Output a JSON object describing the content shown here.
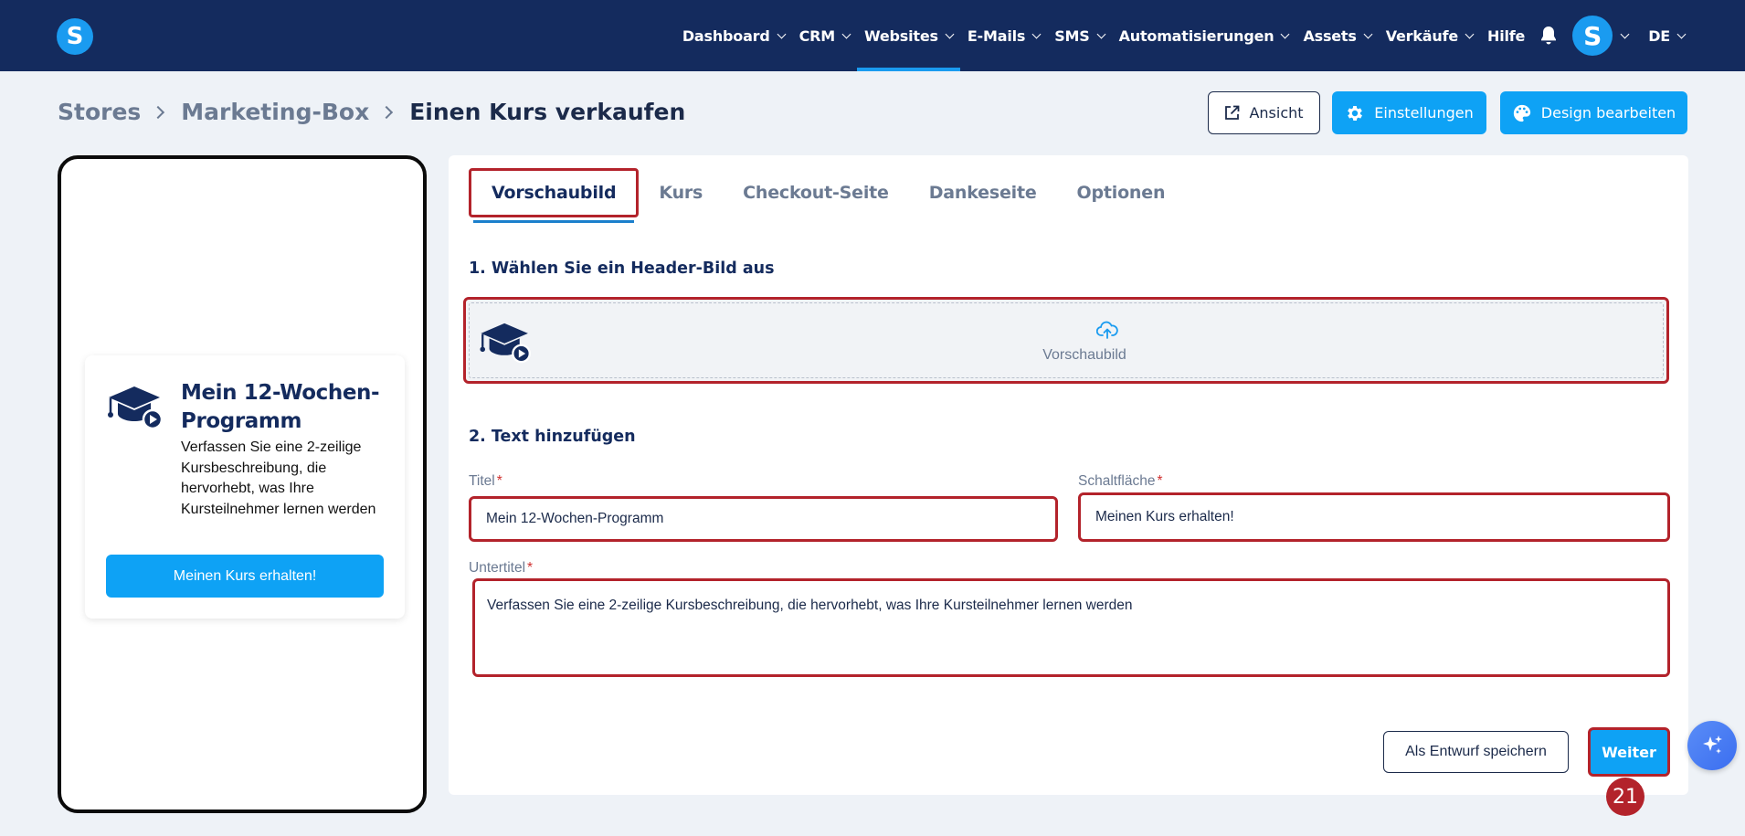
{
  "brand": {
    "logo_letter": "S"
  },
  "nav": {
    "items": [
      {
        "label": "Dashboard",
        "has_menu": true,
        "active": false
      },
      {
        "label": "CRM",
        "has_menu": true,
        "active": false
      },
      {
        "label": "Websites",
        "has_menu": true,
        "active": true
      },
      {
        "label": "E-Mails",
        "has_menu": true,
        "active": false
      },
      {
        "label": "SMS",
        "has_menu": true,
        "active": false
      },
      {
        "label": "Automatisierungen",
        "has_menu": true,
        "active": false
      },
      {
        "label": "Assets",
        "has_menu": true,
        "active": false
      },
      {
        "label": "Verkäufe",
        "has_menu": true,
        "active": false
      },
      {
        "label": "Hilfe",
        "has_menu": false,
        "active": false
      }
    ],
    "avatar_letter": "S",
    "language": "DE"
  },
  "breadcrumb": {
    "items": [
      "Stores",
      "Marketing-Box",
      "Einen Kurs verkaufen"
    ]
  },
  "header_actions": {
    "view_label": "Ansicht",
    "settings_label": "Einstellungen",
    "design_label": "Design bearbeiten"
  },
  "preview": {
    "title": "Mein 12-Wochen-Programm",
    "subtitle": "Verfassen Sie eine 2-zeilige Kursbeschreibung, die hervorhebt, was Ihre Kursteilnehmer lernen werden",
    "button": "Meinen Kurs erhalten!"
  },
  "tabs": [
    {
      "label": "Vorschaubild",
      "active": true
    },
    {
      "label": "Kurs",
      "active": false
    },
    {
      "label": "Checkout-Seite",
      "active": false
    },
    {
      "label": "Dankeseite",
      "active": false
    },
    {
      "label": "Optionen",
      "active": false
    }
  ],
  "form": {
    "section1_title": "1. Wählen Sie ein Header-Bild aus",
    "dropzone_label": "Vorschaubild",
    "section2_title": "2. Text hinzufügen",
    "title_label": "Titel",
    "title_value": "Mein 12-Wochen-Programm",
    "button_label": "Schaltfläche",
    "button_value": "Meinen Kurs erhalten!",
    "subtitle_label": "Untertitel",
    "subtitle_value": "Verfassen Sie eine 2-zeilige Kursbeschreibung, die hervorhebt, was Ihre Kursteilnehmer lernen werden",
    "required_mark": "*"
  },
  "footer_actions": {
    "draft_label": "Als Entwurf speichern",
    "next_label": "Weiter"
  },
  "step_badge": "21",
  "colors": {
    "nav_bg": "#142b5e",
    "primary": "#0ea2f5",
    "highlight": "#b3232b"
  }
}
